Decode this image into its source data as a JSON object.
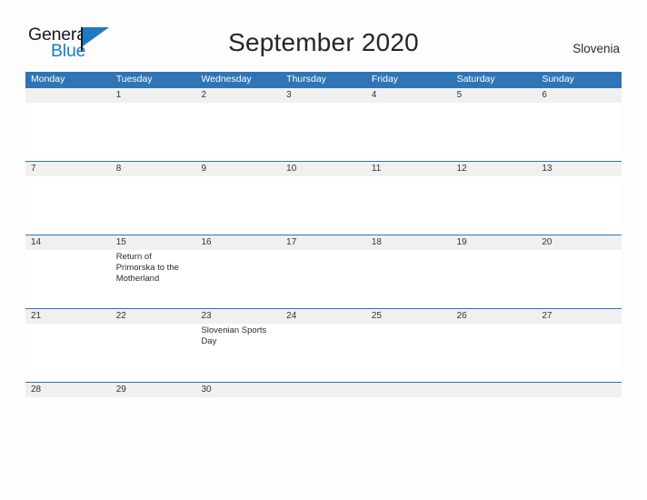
{
  "brand": {
    "name_part1": "General",
    "name_part2": "Blue",
    "accent_color": "#1f7ac4"
  },
  "header": {
    "title": "September 2020",
    "region": "Slovenia"
  },
  "theme": {
    "header_blue": "#2f75b6",
    "day_band_gray": "#f0f0f0",
    "page_background": "#fdfdfe"
  },
  "calendar": {
    "weekdays": [
      "Monday",
      "Tuesday",
      "Wednesday",
      "Thursday",
      "Friday",
      "Saturday",
      "Sunday"
    ],
    "weeks": [
      [
        {
          "date": "",
          "events": []
        },
        {
          "date": "1",
          "events": []
        },
        {
          "date": "2",
          "events": []
        },
        {
          "date": "3",
          "events": []
        },
        {
          "date": "4",
          "events": []
        },
        {
          "date": "5",
          "events": []
        },
        {
          "date": "6",
          "events": []
        }
      ],
      [
        {
          "date": "7",
          "events": []
        },
        {
          "date": "8",
          "events": []
        },
        {
          "date": "9",
          "events": []
        },
        {
          "date": "10",
          "events": []
        },
        {
          "date": "11",
          "events": []
        },
        {
          "date": "12",
          "events": []
        },
        {
          "date": "13",
          "events": []
        }
      ],
      [
        {
          "date": "14",
          "events": []
        },
        {
          "date": "15",
          "events": [
            "Return of Primorska to the Motherland"
          ]
        },
        {
          "date": "16",
          "events": []
        },
        {
          "date": "17",
          "events": []
        },
        {
          "date": "18",
          "events": []
        },
        {
          "date": "19",
          "events": []
        },
        {
          "date": "20",
          "events": []
        }
      ],
      [
        {
          "date": "21",
          "events": []
        },
        {
          "date": "22",
          "events": []
        },
        {
          "date": "23",
          "events": [
            "Slovenian Sports Day"
          ]
        },
        {
          "date": "24",
          "events": []
        },
        {
          "date": "25",
          "events": []
        },
        {
          "date": "26",
          "events": []
        },
        {
          "date": "27",
          "events": []
        }
      ],
      [
        {
          "date": "28",
          "events": []
        },
        {
          "date": "29",
          "events": []
        },
        {
          "date": "30",
          "events": []
        },
        {
          "date": "",
          "events": []
        },
        {
          "date": "",
          "events": []
        },
        {
          "date": "",
          "events": []
        },
        {
          "date": "",
          "events": []
        }
      ]
    ]
  }
}
